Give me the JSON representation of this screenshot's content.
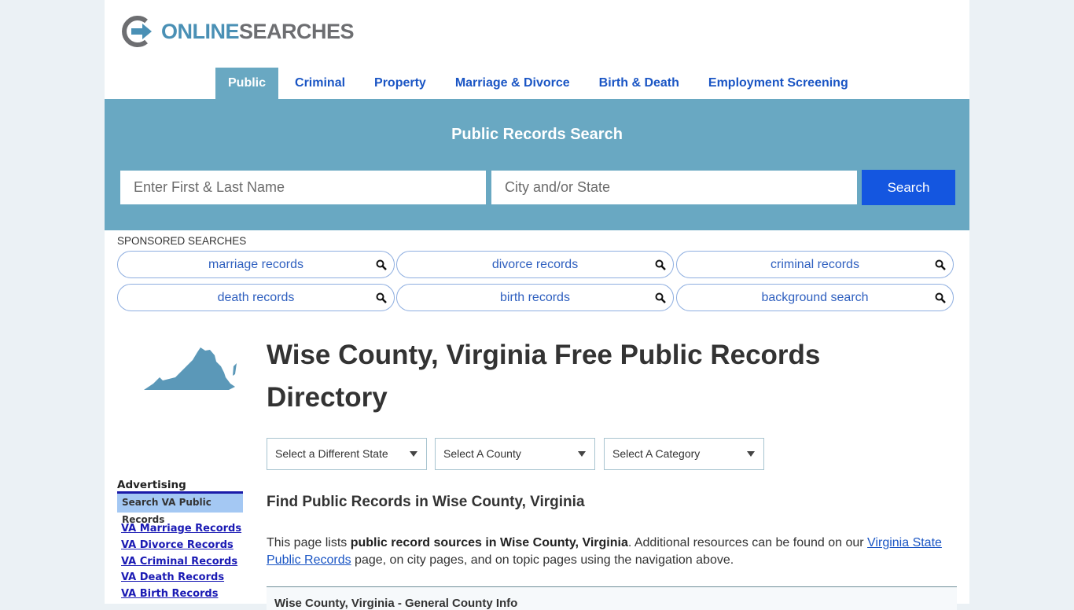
{
  "brand": {
    "name_part1": "ONLINE",
    "name_part2": "SEARCHES"
  },
  "nav": {
    "items": [
      {
        "label": "Public",
        "active": true
      },
      {
        "label": "Criminal"
      },
      {
        "label": "Property"
      },
      {
        "label": "Marriage & Divorce"
      },
      {
        "label": "Birth & Death"
      },
      {
        "label": "Employment Screening"
      }
    ]
  },
  "hero": {
    "title": "Public Records Search",
    "name_placeholder": "Enter First & Last Name",
    "name_value": "",
    "city_placeholder": "City and/or State",
    "city_value": "",
    "search_label": "Search"
  },
  "sponsored": {
    "label": "SPONSORED SEARCHES",
    "items": [
      "marriage records",
      "divorce records",
      "criminal records",
      "death records",
      "birth records",
      "background search"
    ]
  },
  "main": {
    "title": "Wise County, Virginia Free Public Records Directory",
    "selects": [
      "Select a Different State",
      "Select A County",
      "Select A Category"
    ],
    "subtitle": "Find Public Records in Wise County, Virginia",
    "para": {
      "pre": "This page lists ",
      "bold": "public record sources in Wise County, Virginia",
      "mid": ". Additional resources can be found on our ",
      "link": "Virginia State Public Records",
      "post": " page, on city pages, and on topic pages using the navigation above."
    },
    "info_box_title": "Wise County, Virginia - General County Info"
  },
  "sidebar": {
    "adv_title": "Advertising",
    "adv_box": "Search VA Public Records",
    "links": [
      "VA Marriage Records",
      "VA Divorce Records",
      "VA Criminal Records",
      "VA Death Records",
      "VA Birth Records"
    ]
  },
  "colors": {
    "accent": "#69a8c2",
    "nav_link": "#1a55c4",
    "search_button": "#1456e0",
    "map_fill": "#5b98b8"
  }
}
